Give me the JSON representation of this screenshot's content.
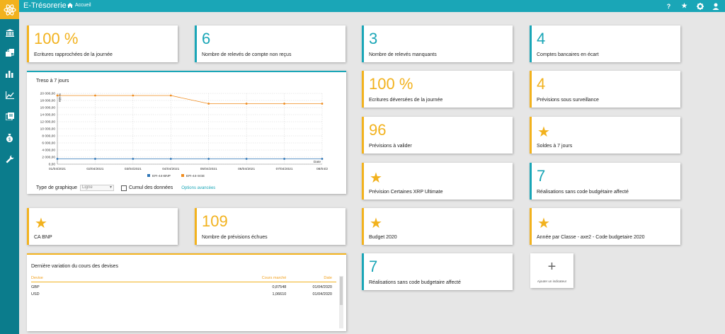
{
  "header": {
    "app_title": "E-Trésorerie",
    "home_link": "Accueil",
    "icons": [
      "help-icon",
      "star-icon",
      "settings-gear-icon",
      "user-icon"
    ],
    "colors": {
      "accent_teal": "#1aa6b7",
      "sidebar": "#0b7c8c",
      "accent_yellow": "#f2b21e"
    }
  },
  "sidebar": {
    "items": [
      "bank-icon",
      "documents-icon",
      "bar-chart-icon",
      "line-chart-icon",
      "reports-icon",
      "money-bag-icon",
      "wrench-icon"
    ]
  },
  "cards": {
    "c1": {
      "value": "100 %",
      "label": "Ecritures rapprochées de la journée"
    },
    "c2": {
      "value": "6",
      "label": "Nombre de relevés de compte non reçus"
    },
    "c3": {
      "value": "3",
      "label": "Nombre de relevés manquants"
    },
    "c4": {
      "value": "4",
      "label": "Comptes bancaires en écart"
    },
    "c5": {
      "value": "100 %",
      "label": "Ecritures déversées de la journée"
    },
    "c6": {
      "value": "4",
      "label": "Prévisions sous surveillance"
    },
    "c7": {
      "value": "96",
      "label": "Prévisions à valider"
    },
    "c8": {
      "value": "★",
      "label": "Soldes à 7 jours"
    },
    "c9": {
      "value": "★",
      "label": "Prévision Certaines XRP Ultimate"
    },
    "c10": {
      "value": "7",
      "label": "Réalisations sans code budgétaire affecté"
    },
    "c11": {
      "value": "★",
      "label": "CA BNP"
    },
    "c12": {
      "value": "109",
      "label": "Nombre de prévisions échues"
    },
    "c13": {
      "value": "★",
      "label": "Budget 2020"
    },
    "c14": {
      "value": "★",
      "label": "Année par Classe - axe2 - Code budgetaire 2020"
    },
    "c15": {
      "value": "7",
      "label": "Réalisations sans code budgetaire affecté"
    }
  },
  "chart_panel": {
    "title": "Treso à 7 jours",
    "chart_type_label": "Type de graphique",
    "chart_type_value": "Ligne",
    "cumul_label": "Cumul des données",
    "options_link": "Options avancées"
  },
  "chart_data": {
    "type": "line",
    "x": [
      "01/04/2021",
      "02/04/2021",
      "03/04/2021",
      "04/04/2021",
      "05/04/2021",
      "06/04/2021",
      "07/04/2021",
      "08/04/2"
    ],
    "xlabel": "Date",
    "ylabel": "Solde",
    "ylim": [
      0,
      20000
    ],
    "yticks": [
      "0,00",
      "2 000,00",
      "4 000,00",
      "6 000,00",
      "8 000,00",
      "10 000,00",
      "12 000,00",
      "14 000,00",
      "16 000,00",
      "18 000,00",
      "20 000,00"
    ],
    "series": [
      {
        "name": "EFI-44-BNP",
        "color": "#2e75b6",
        "values": [
          1500,
          1500,
          1500,
          1500,
          1500,
          1500,
          1500,
          1500
        ]
      },
      {
        "name": "EFI-44-SGE",
        "color": "#f08c1e",
        "values": [
          19400,
          19400,
          19400,
          19400,
          17100,
          17100,
          17100,
          17100
        ]
      }
    ],
    "grid": true,
    "legend": "bottom"
  },
  "fx_panel": {
    "title": "Dernière variation du cours des devises",
    "columns": [
      "Devise",
      "Cours marché",
      "Date"
    ],
    "rows": [
      [
        "GBP",
        "0,87548",
        "01/04/2020"
      ],
      [
        "USD",
        "1,06610",
        "01/04/2020"
      ]
    ]
  },
  "add_card": {
    "plus": "+",
    "label": "Ajouter un indicateur"
  }
}
